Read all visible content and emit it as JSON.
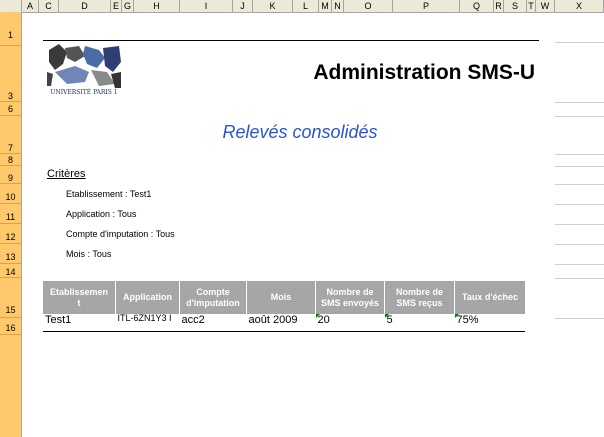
{
  "columns": [
    "A",
    "C",
    "D",
    "E",
    "G",
    "H",
    "I",
    "J",
    "K",
    "L",
    "M",
    "N",
    "O",
    "P",
    "Q",
    "R",
    "S",
    "T",
    "W",
    "X"
  ],
  "rows": [
    "1",
    "3",
    "6",
    "7",
    "8",
    "9",
    "10",
    "11",
    "12",
    "13",
    "14",
    "15",
    "16"
  ],
  "logo": {
    "text": "UNIVERSITÉ PARIS 1"
  },
  "header": {
    "title": "Administration SMS-U"
  },
  "report": {
    "subtitle": "Relevés consolidés"
  },
  "criteria": {
    "heading": "Critères",
    "items": [
      "Etablissement : Test1",
      "Application : Tous",
      "Compte d'imputation : Tous",
      "Mois : Tous"
    ]
  },
  "table": {
    "headers": [
      "Etablissement",
      "Application",
      "Compte d'imputation",
      "Mois",
      "Nombre de SMS envoyés",
      "Nombre de SMS reçus",
      "Taux d'échec"
    ],
    "header_lines": [
      [
        "Etablissemen",
        "t"
      ],
      [
        "Application"
      ],
      [
        "Compte",
        "d'imputation"
      ],
      [
        "Mois"
      ],
      [
        "Nombre de",
        "SMS envoyés"
      ],
      [
        "Nombre de",
        "SMS reçus"
      ],
      [
        "Taux d'échec"
      ]
    ],
    "rows": [
      {
        "etablissement": "Test1",
        "application": "ITL-6ZN1Y3 I",
        "compte": "acc2",
        "mois": "août 2009",
        "envoyes": "20",
        "recus": "5",
        "taux": "75%"
      }
    ]
  },
  "colors": {
    "accent": "#2a52d6",
    "header_bg": "#a6a6a6",
    "row_header_bg": "#ffc96b"
  }
}
